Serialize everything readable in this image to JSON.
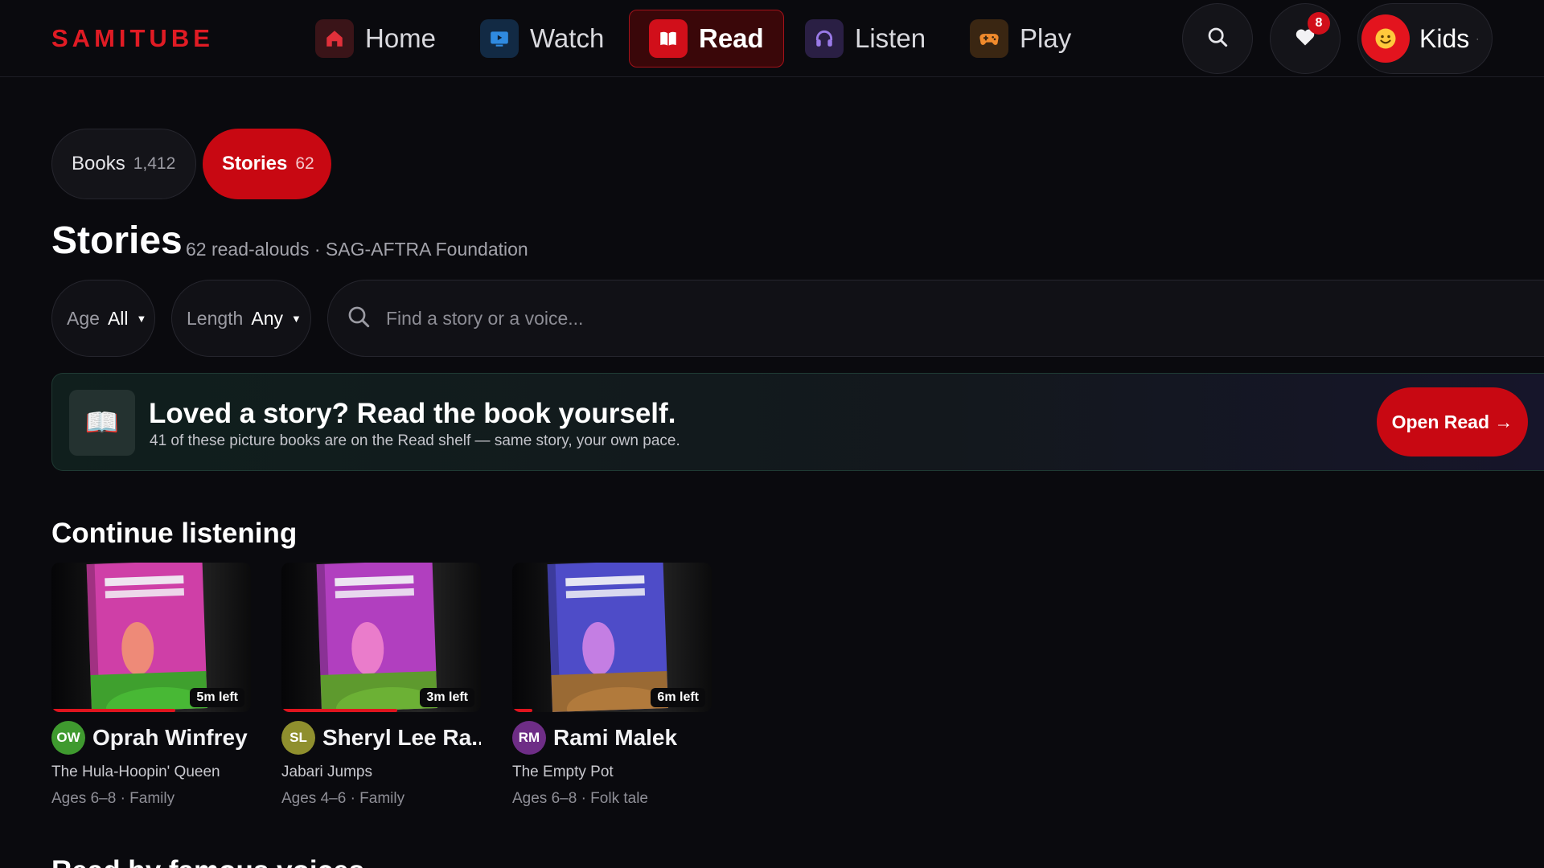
{
  "nav": {
    "logo": "SAMITUBE",
    "items": [
      {
        "label": "Home",
        "icon": "house-icon",
        "active": false
      },
      {
        "label": "Watch",
        "icon": "tv-icon",
        "active": false
      },
      {
        "label": "Read",
        "icon": "book-icon",
        "active": true
      },
      {
        "label": "Listen",
        "icon": "headphones-icon",
        "active": false
      },
      {
        "label": "Play",
        "icon": "gamepad-icon",
        "active": false
      }
    ],
    "favorites_badge": "8",
    "profile_label": "Kids",
    "profile_dot": "·"
  },
  "segments": [
    {
      "label": "Books",
      "count": "1,412",
      "active": false
    },
    {
      "label": "Stories",
      "count": "62",
      "active": true
    }
  ],
  "page": {
    "title": "Stories",
    "subtitle": "62 read-alouds · SAG-AFTRA Foundation"
  },
  "filters": {
    "age_label": "Age",
    "age_value": "All",
    "length_label": "Length",
    "length_value": "Any",
    "search_placeholder": "Find a story or a voice..."
  },
  "banner": {
    "icon": "open-book-icon",
    "title": "Loved a story? Read the book yourself.",
    "subtitle": "41 of these picture books are on the Read shelf — same story, your own pace.",
    "button": "Open Read →"
  },
  "continue_listening": {
    "title": "Continue listening",
    "items": [
      {
        "initials": "OW",
        "narrator": "Oprah Winfrey",
        "story": "The Hula-Hoopin' Queen",
        "meta": "Ages 6–8 · Family",
        "time_left": "5m left",
        "progress": 0.62,
        "avatar_color": "#3f9a2f",
        "cover_color": "#cf3fa7",
        "face_color": "#ee8a78",
        "ground_color": "#3fa02e"
      },
      {
        "initials": "SL",
        "narrator": "Sheryl Lee Ra...",
        "story": "Jabari Jumps",
        "meta": "Ages 4–6 · Family",
        "time_left": "3m left",
        "progress": 0.58,
        "avatar_color": "#8f8f2e",
        "cover_color": "#b13fbf",
        "face_color": "#ea7ccb",
        "ground_color": "#5e9a2e"
      },
      {
        "initials": "RM",
        "narrator": "Rami Malek",
        "story": "The Empty Pot",
        "meta": "Ages 6–8 · Folk tale",
        "time_left": "6m left",
        "progress": 0.1,
        "avatar_color": "#6e2d86",
        "cover_color": "#4e4cc8",
        "face_color": "#c47ee3",
        "ground_color": "#9a6a34"
      }
    ]
  },
  "next_section_title": "Read by famous voices"
}
